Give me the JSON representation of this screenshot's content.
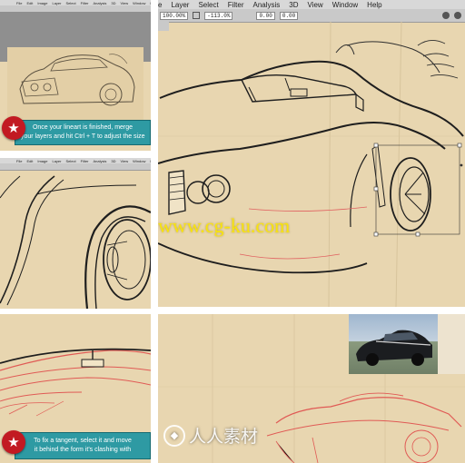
{
  "panel_main": {
    "menu": [
      "e",
      "Layer",
      "Select",
      "Filter",
      "Analysis",
      "3D",
      "View",
      "Window",
      "Help"
    ],
    "options": [
      "100.00%",
      "-113.0%",
      "0.00",
      "0.00"
    ]
  },
  "panel_top_left": {
    "tip_lines": [
      "Once your lineart is finished, merge",
      "your layers and hit Ctrl + T to adjust the size"
    ]
  },
  "panel_bottom_left": {
    "tip_lines": [
      "To fix a tangent, select it and move",
      "it behind the form it's clashing with"
    ]
  },
  "watermark": "www.cg-ku.com",
  "logo_watermark": "人人素材",
  "colors": {
    "paper": "#e8d6b0",
    "tip": "#2e9aa3",
    "badge": "#c21a22",
    "sketch_red": "#e0605a",
    "ink": "#1e1e1e"
  }
}
